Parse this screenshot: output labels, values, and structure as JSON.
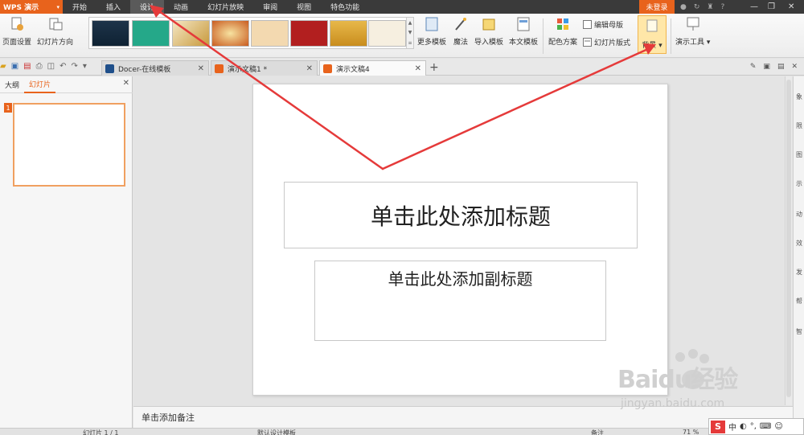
{
  "app": {
    "name": "WPS 演示",
    "login": "未登录"
  },
  "menu": {
    "tabs": [
      "开始",
      "插入",
      "设计",
      "动画",
      "幻灯片放映",
      "审阅",
      "视图",
      "特色功能"
    ],
    "active": "设计"
  },
  "ribbon": {
    "page_setup": "页面设置",
    "slide_orientation": "幻灯片方向",
    "more_templates": "更多模板",
    "magic": "魔法",
    "import_template": "导入模板",
    "this_template": "本文模板",
    "color_scheme": "配色方案",
    "edit_master": "编辑母版",
    "slide_layout": "幻灯片版式",
    "background": "背景",
    "presentation_tools": "演示工具"
  },
  "doc_tabs": [
    {
      "label": "Docer-在线模板"
    },
    {
      "label": "演示文稿1 *"
    },
    {
      "label": "演示文稿4"
    }
  ],
  "left_pane": {
    "tabs": [
      "大纲",
      "幻灯片"
    ],
    "active": "幻灯片",
    "slide_number": "1"
  },
  "slide": {
    "title_placeholder": "单击此处添加标题",
    "subtitle_placeholder": "单击此处添加副标题"
  },
  "notes_placeholder": "单击添加备注",
  "status": {
    "slide_info": "幻灯片 1 / 1",
    "template": "默认设计模板",
    "notes_label": "备注",
    "zoom": "71 %"
  },
  "side_panel_icons": [
    "象",
    "限",
    "图",
    "示",
    "动",
    "效",
    "发",
    "帮",
    "智"
  ],
  "watermark": {
    "brand": "Baidu经验",
    "url": "jingyan.baidu.com"
  },
  "ime": {
    "label": "中"
  },
  "colors": {
    "accent": "#e8631c",
    "annotation": "#e53a3a"
  }
}
